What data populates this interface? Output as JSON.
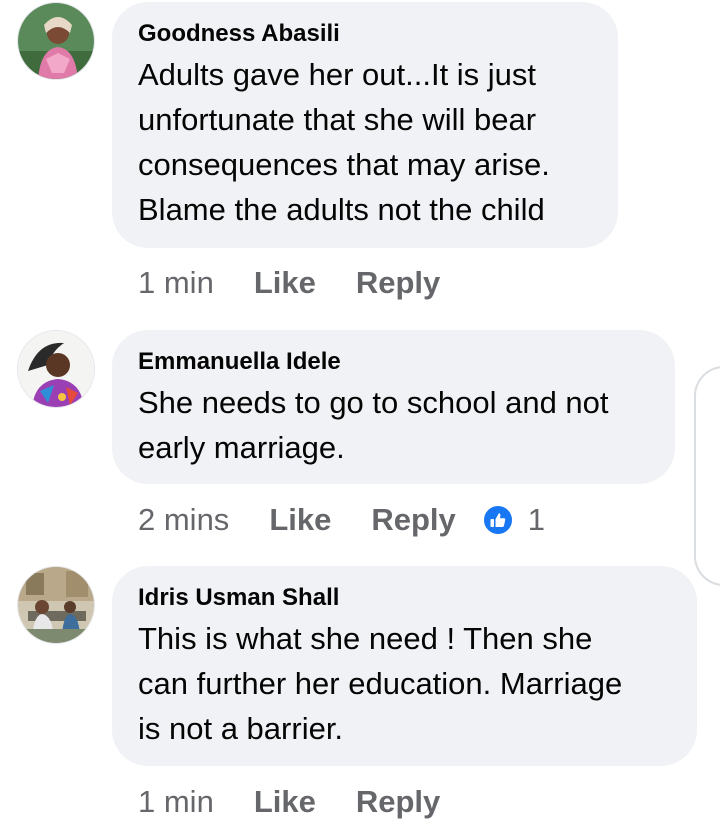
{
  "comments": [
    {
      "author": "Goodness Abasili",
      "lines": [
        "Adults gave her out...It is just",
        "unfortunate that she will bear",
        "consequences that may arise.",
        "Blame the adults not the child"
      ],
      "time": "1 min",
      "like_label": "Like",
      "reply_label": "Reply"
    },
    {
      "author": "Emmanuella Idele",
      "lines": [
        "She needs to go to school and not",
        "early marriage."
      ],
      "time": "2 mins",
      "like_label": "Like",
      "reply_label": "Reply",
      "reaction_icon": "thumbs-up-icon",
      "reaction_count": "1"
    },
    {
      "author": "Idris Usman Shall",
      "lines": [
        "This is what she need ! Then she",
        "can further her education. Marriage",
        "is not a barrier."
      ],
      "time": "1 min",
      "like_label": "Like",
      "reply_label": "Reply"
    }
  ],
  "colors": {
    "bubble": "#f0f2f5",
    "meta_text": "#65676b",
    "reaction": "#1877f2"
  }
}
